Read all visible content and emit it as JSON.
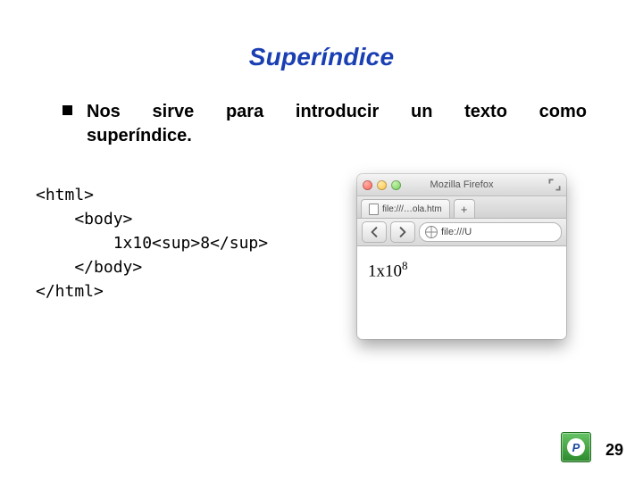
{
  "title": "Superíndice",
  "bullet": {
    "line1": "Nos sirve para introducir un texto como",
    "line2": "superíndice."
  },
  "code": {
    "l1": "<html>",
    "l2": "    <body>",
    "l3": "        1x10<sup>8</sup>",
    "l4": "    </body>",
    "l5": "</html>"
  },
  "browser": {
    "window_title": "Mozilla Firefox",
    "tab_label": "file:///…ola.htm",
    "new_tab_symbol": "+",
    "url_text": "file:///U",
    "content_base": "1x10",
    "content_exp": "8"
  },
  "footer": {
    "logo_letter": "P",
    "page_number": "29"
  }
}
